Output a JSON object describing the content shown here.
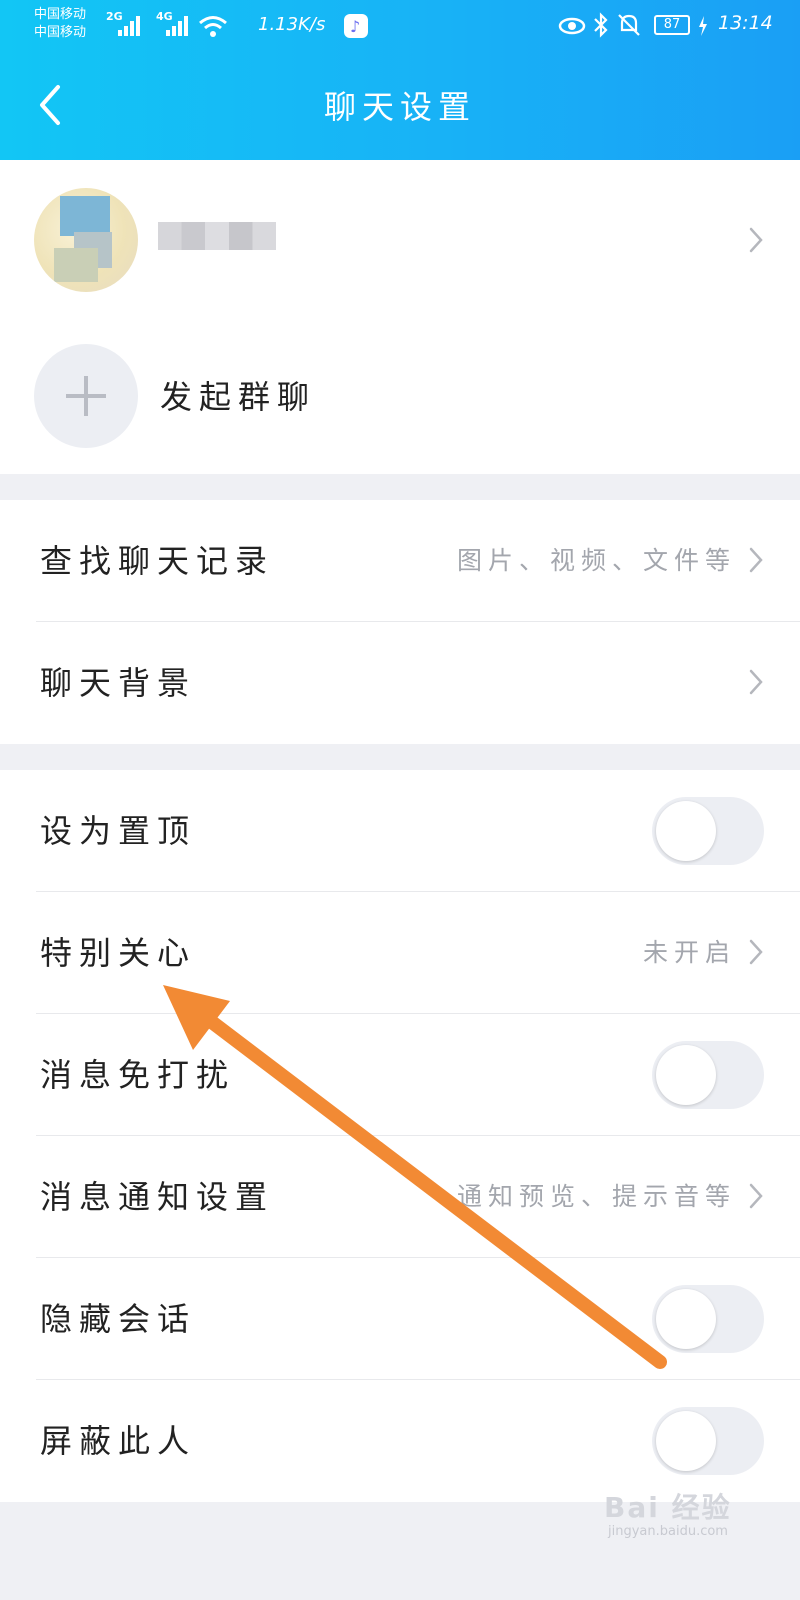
{
  "status_bar": {
    "carrier_1": "中国移动",
    "carrier_2": "中国移动",
    "network_1": "2G",
    "network_2": "4G",
    "speed": "1.13K/s",
    "battery": "87",
    "time": "13:14"
  },
  "header": {
    "title": "聊天设置",
    "back_icon": "chevron-left-icon"
  },
  "profile": {
    "add_group_label": "发起群聊"
  },
  "section1": {
    "search_label": "查找聊天记录",
    "search_hint": "图片、视频、文件等",
    "background_label": "聊天背景"
  },
  "section2": {
    "pin_label": "设为置顶",
    "special_care_label": "特别关心",
    "special_care_hint": "未开启",
    "dnd_label": "消息免打扰",
    "notify_label": "消息通知设置",
    "notify_hint": "通知预览、提示音等",
    "hide_label": "隐藏会话",
    "block_label": "屏蔽此人"
  },
  "toggles": {
    "pin": false,
    "dnd": false,
    "hide": false,
    "block": false
  },
  "annotation": {
    "arrow_color": "#f28a34"
  },
  "watermark": {
    "main": "Bai 经验",
    "sub": "jingyan.baidu.com"
  }
}
